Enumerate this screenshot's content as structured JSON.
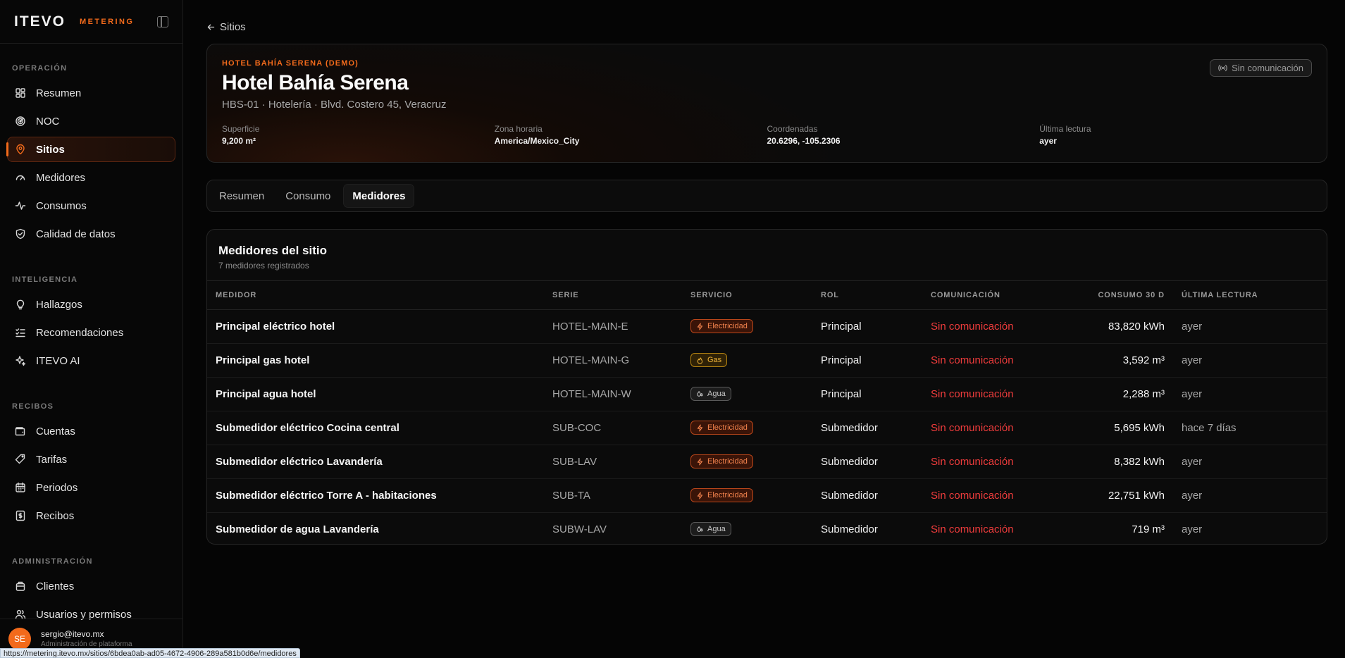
{
  "brand": {
    "logo": "ITEVO",
    "product": "METERING"
  },
  "sidebar": {
    "sections": [
      {
        "label": "OPERACIÓN",
        "items": [
          {
            "label": "Resumen",
            "icon": "dashboard-icon"
          },
          {
            "label": "NOC",
            "icon": "radar-icon"
          },
          {
            "label": "Sitios",
            "icon": "map-pin-icon",
            "active": true
          },
          {
            "label": "Medidores",
            "icon": "gauge-icon"
          },
          {
            "label": "Consumos",
            "icon": "activity-icon"
          },
          {
            "label": "Calidad de datos",
            "icon": "shield-check-icon"
          }
        ]
      },
      {
        "label": "INTELIGENCIA",
        "items": [
          {
            "label": "Hallazgos",
            "icon": "lightbulb-icon"
          },
          {
            "label": "Recomendaciones",
            "icon": "list-checks-icon"
          },
          {
            "label": "ITEVO AI",
            "icon": "sparkles-icon"
          }
        ]
      },
      {
        "label": "RECIBOS",
        "items": [
          {
            "label": "Cuentas",
            "icon": "wallet-icon"
          },
          {
            "label": "Tarifas",
            "icon": "tag-icon"
          },
          {
            "label": "Periodos",
            "icon": "calendar-icon"
          },
          {
            "label": "Recibos",
            "icon": "receipt-icon"
          }
        ]
      },
      {
        "label": "ADMINISTRACIÓN",
        "items": [
          {
            "label": "Clientes",
            "icon": "building-icon"
          },
          {
            "label": "Usuarios y permisos",
            "icon": "users-icon"
          }
        ]
      }
    ]
  },
  "user": {
    "initials": "SE",
    "email": "sergio@itevo.mx",
    "role": "Administración de plataforma"
  },
  "status_url": "https://metering.itevo.mx/sitios/6bdea0ab-ad05-4672-4906-289a581b0d6e/medidores",
  "back": {
    "label": "Sitios"
  },
  "site": {
    "eyebrow": "HOTEL BAHÍA SERENA (DEMO)",
    "title": "Hotel Bahía Serena",
    "subtitle": "HBS-01 · Hotelería · Blvd. Costero 45, Veracruz",
    "status": "Sin comunicación",
    "stats": [
      {
        "label": "Superficie",
        "value": "9,200 m²"
      },
      {
        "label": "Zona horaria",
        "value": "America/Mexico_City"
      },
      {
        "label": "Coordenadas",
        "value": "20.6296, -105.2306"
      },
      {
        "label": "Última lectura",
        "value": "ayer"
      }
    ]
  },
  "tabs": [
    {
      "label": "Resumen"
    },
    {
      "label": "Consumo"
    },
    {
      "label": "Medidores",
      "active": true
    }
  ],
  "meters": {
    "title": "Medidores del sitio",
    "subtitle": "7 medidores registrados",
    "columns": [
      "MEDIDOR",
      "SERIE",
      "SERVICIO",
      "ROL",
      "COMUNICACIÓN",
      "CONSUMO 30 D",
      "ÚLTIMA LECTURA"
    ],
    "rows": [
      {
        "name": "Principal eléctrico hotel",
        "serie": "HOTEL-MAIN-E",
        "service": "Electricidad",
        "kind": "elec",
        "role": "Principal",
        "com": "Sin comunicación",
        "consumo": "83,820 kWh",
        "last": "ayer"
      },
      {
        "name": "Principal gas hotel",
        "serie": "HOTEL-MAIN-G",
        "service": "Gas",
        "kind": "gas",
        "role": "Principal",
        "com": "Sin comunicación",
        "consumo": "3,592 m³",
        "last": "ayer"
      },
      {
        "name": "Principal agua hotel",
        "serie": "HOTEL-MAIN-W",
        "service": "Agua",
        "kind": "agua",
        "role": "Principal",
        "com": "Sin comunicación",
        "consumo": "2,288 m³",
        "last": "ayer"
      },
      {
        "name": "Submedidor eléctrico Cocina central",
        "serie": "SUB-COC",
        "service": "Electricidad",
        "kind": "elec",
        "role": "Submedidor",
        "com": "Sin comunicación",
        "consumo": "5,695 kWh",
        "last": "hace 7 días"
      },
      {
        "name": "Submedidor eléctrico Lavandería",
        "serie": "SUB-LAV",
        "service": "Electricidad",
        "kind": "elec",
        "role": "Submedidor",
        "com": "Sin comunicación",
        "consumo": "8,382 kWh",
        "last": "ayer"
      },
      {
        "name": "Submedidor eléctrico Torre A - habitaciones",
        "serie": "SUB-TA",
        "service": "Electricidad",
        "kind": "elec",
        "role": "Submedidor",
        "com": "Sin comunicación",
        "consumo": "22,751 kWh",
        "last": "ayer"
      },
      {
        "name": "Submedidor de agua Lavandería",
        "serie": "SUBW-LAV",
        "service": "Agua",
        "kind": "agua",
        "role": "Submedidor",
        "com": "Sin comunicación",
        "consumo": "719 m³",
        "last": "ayer"
      }
    ]
  }
}
